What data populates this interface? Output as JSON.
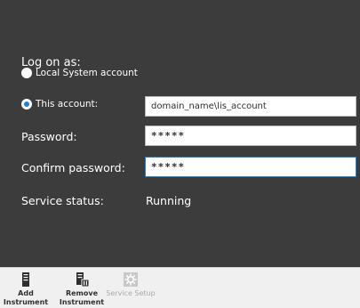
{
  "logon": {
    "title": "Log on as:",
    "local_option": "Local System account",
    "this_option": "This account:",
    "selected": "this_account"
  },
  "account": {
    "value": "domain_name\\lis_account"
  },
  "password": {
    "label": "Password:",
    "value": "*****"
  },
  "confirm": {
    "label": "Confirm password:",
    "value": "*****"
  },
  "service": {
    "label": "Service status:",
    "value": "Running"
  },
  "toolbar": {
    "add_label": "Add Instrument",
    "remove_label": "Remove Instrument",
    "service_label": "Service Setup"
  },
  "colors": {
    "panel_bg": "#3c3c3c",
    "accent": "#1e7fd6",
    "toolbar_bg": "#f0f0f0"
  },
  "icons": {
    "add": "server-icon",
    "remove": "server-remove-icon",
    "service": "gear-icon"
  }
}
